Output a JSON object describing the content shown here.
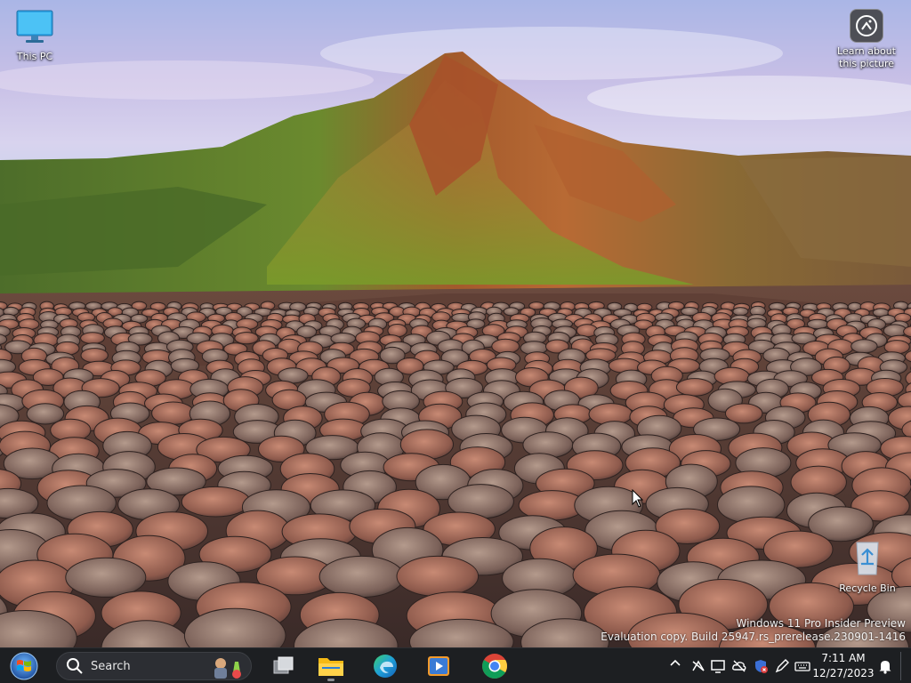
{
  "desktop": {
    "icons": [
      {
        "label": "This PC",
        "icon": "monitor-icon"
      },
      {
        "label": "Learn about this picture",
        "icon": "camera-icon"
      },
      {
        "label": "Recycle Bin",
        "icon": "recycle-bin-icon"
      }
    ],
    "watermark": {
      "line1": "Windows 11 Pro Insider Preview",
      "line2": "Evaluation copy. Build 25947.rs_prerelease.230901-1416"
    }
  },
  "taskbar": {
    "start_icon": "windows-start-icon",
    "search_placeholder": "Search",
    "apps": [
      {
        "name": "task-view",
        "icon": "task-view-icon"
      },
      {
        "name": "file-explorer",
        "icon": "folder-icon"
      },
      {
        "name": "edge",
        "icon": "edge-icon"
      },
      {
        "name": "media-player",
        "icon": "media-player-icon"
      },
      {
        "name": "chrome",
        "icon": "chrome-icon"
      }
    ],
    "tray": {
      "icons": [
        "chevron-up-icon",
        "network-icon",
        "display-icon",
        "cloud-icon",
        "security-icon",
        "pen-icon",
        "keyboard-icon",
        "notification-bell-icon"
      ],
      "time": "7:11 AM",
      "date": "12/27/2023"
    }
  },
  "colors": {
    "taskbar_bg": "#1d1f22",
    "accent": "#0078d4"
  }
}
